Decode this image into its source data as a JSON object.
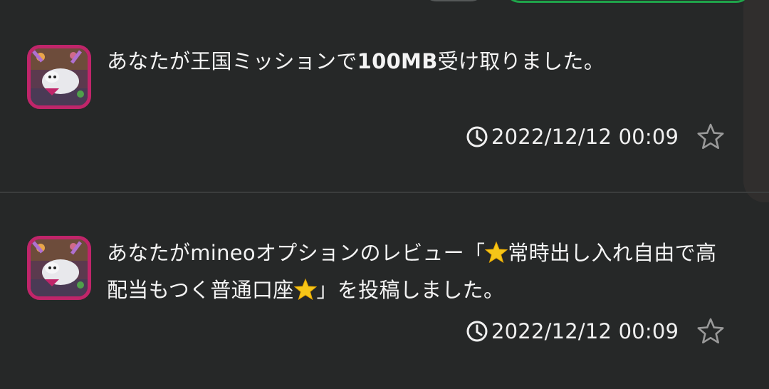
{
  "notifications": [
    {
      "message_prefix": "あなたが王国ミッションで",
      "message_bold": "100MB",
      "message_suffix": "受け取りました。",
      "timestamp": "2022/12/12 00:09",
      "avatar_icon": "kingdom-avatar-icon",
      "favorite_icon": "star-outline-icon"
    },
    {
      "message_part1": "あなたがmineoオプションのレビュー「",
      "message_part2": "常時出し入れ自由で高配当もつく普通口座",
      "message_part3": "」を投稿しました。",
      "timestamp": "2022/12/12 00:09",
      "avatar_icon": "kingdom-avatar-icon",
      "favorite_icon": "star-outline-icon",
      "inline_icon": "glowing-star-emoji"
    }
  ],
  "colors": {
    "background": "#262828",
    "avatar_border": "#c0256a",
    "accent_green": "#1fa54a",
    "emoji_star": "#f5c518"
  }
}
